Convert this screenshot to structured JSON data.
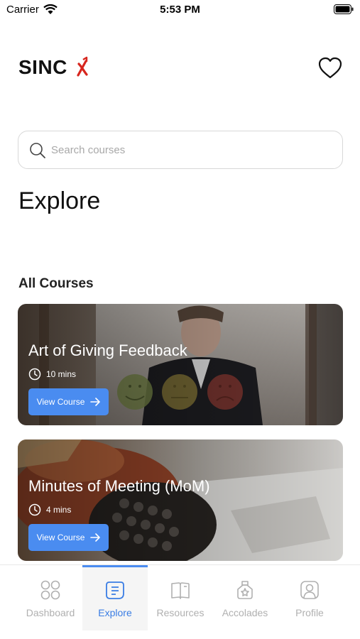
{
  "status_bar": {
    "carrier": "Carrier",
    "time": "5:53 PM"
  },
  "header": {
    "logo_text": "SINC",
    "logo_mark": "x",
    "favorites_icon": "heart-icon"
  },
  "search": {
    "placeholder": "Search courses",
    "value": ""
  },
  "page_title": "Explore",
  "section_title": "All Courses",
  "courses": [
    {
      "title": "Art of Giving Feedback",
      "duration": "10 mins",
      "button_label": "View Course"
    },
    {
      "title": "Minutes of Meeting (MoM)",
      "duration": "4 mins",
      "button_label": "View Course"
    }
  ],
  "tabs": [
    {
      "label": "Dashboard",
      "icon": "grid-icon",
      "active": false
    },
    {
      "label": "Explore",
      "icon": "explore-icon",
      "active": true
    },
    {
      "label": "Resources",
      "icon": "book-icon",
      "active": false
    },
    {
      "label": "Accolades",
      "icon": "medal-icon",
      "active": false
    },
    {
      "label": "Profile",
      "icon": "profile-icon",
      "active": false
    }
  ],
  "colors": {
    "accent": "#4a8cf0",
    "logo_accent": "#d7261e",
    "tab_inactive": "#b0b0b0"
  }
}
